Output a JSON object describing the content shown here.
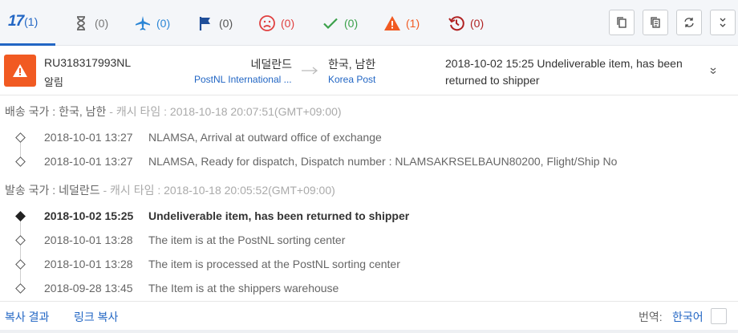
{
  "tabs": [
    {
      "id": "all",
      "icon": "seventeen-logo-icon",
      "logo": "17",
      "count": "(1)",
      "color": "#2266c4"
    },
    {
      "id": "not-found",
      "icon": "hourglass-icon",
      "count": "(0)",
      "color": "#777777"
    },
    {
      "id": "in-transit",
      "icon": "airplane-icon",
      "count": "(0)",
      "color": "#2b86d6"
    },
    {
      "id": "pick-up",
      "icon": "flag-icon",
      "count": "(0)",
      "color": "#1f4e99"
    },
    {
      "id": "undelivered",
      "icon": "sad-face-icon",
      "count": "(0)",
      "color": "#e04040"
    },
    {
      "id": "delivered",
      "icon": "checkmark-icon",
      "count": "(0)",
      "color": "#3aa04a"
    },
    {
      "id": "alert",
      "icon": "warning-icon",
      "count": "(1)",
      "color": "#f15a22"
    },
    {
      "id": "expired",
      "icon": "history-icon",
      "count": "(0)",
      "color": "#b02222"
    }
  ],
  "toolbar": [
    "copy-icon",
    "copy-all-icon",
    "refresh-icon",
    "collapse-all-icon"
  ],
  "shipment": {
    "tracking_number": "RU318317993NL",
    "status_label": "알림",
    "origin_country": "네덜란드",
    "origin_carrier": "PostNL International ...",
    "dest_country": "한국, 남한",
    "dest_carrier": "Korea Post",
    "last_event": "2018-10-02 15:25  Undeliverable item, has been returned to shipper"
  },
  "dest_section": {
    "label": "배송 국가 : 한국, 남한",
    "cache": " - 캐시 타임 : 2018-10-18 20:07:51(GMT+09:00)",
    "events": [
      {
        "datetime": "2018-10-01 13:27",
        "desc": "NLAMSA, Arrival at outward office of exchange"
      },
      {
        "datetime": "2018-10-01 13:27",
        "desc": "NLAMSA, Ready for dispatch, Dispatch number : NLAMSAKRSELBAUN80200, Flight/Ship No"
      }
    ]
  },
  "origin_section": {
    "label": "발송 국가 : 네덜란드",
    "cache": " - 캐시 타임 : 2018-10-18 20:05:52(GMT+09:00)",
    "events": [
      {
        "datetime": "2018-10-02 15:25",
        "desc": "Undeliverable item, has been returned to shipper"
      },
      {
        "datetime": "2018-10-01 13:28",
        "desc": "The item is at the PostNL sorting center"
      },
      {
        "datetime": "2018-10-01 13:28",
        "desc": "The item is processed at the PostNL sorting center"
      },
      {
        "datetime": "2018-09-28 13:45",
        "desc": "The Item is at the shippers warehouse"
      }
    ]
  },
  "footer": {
    "copy_result": "복사 결과",
    "copy_link": "링크 복사",
    "translate_label": "번역:",
    "translate_lang": "한국어"
  }
}
